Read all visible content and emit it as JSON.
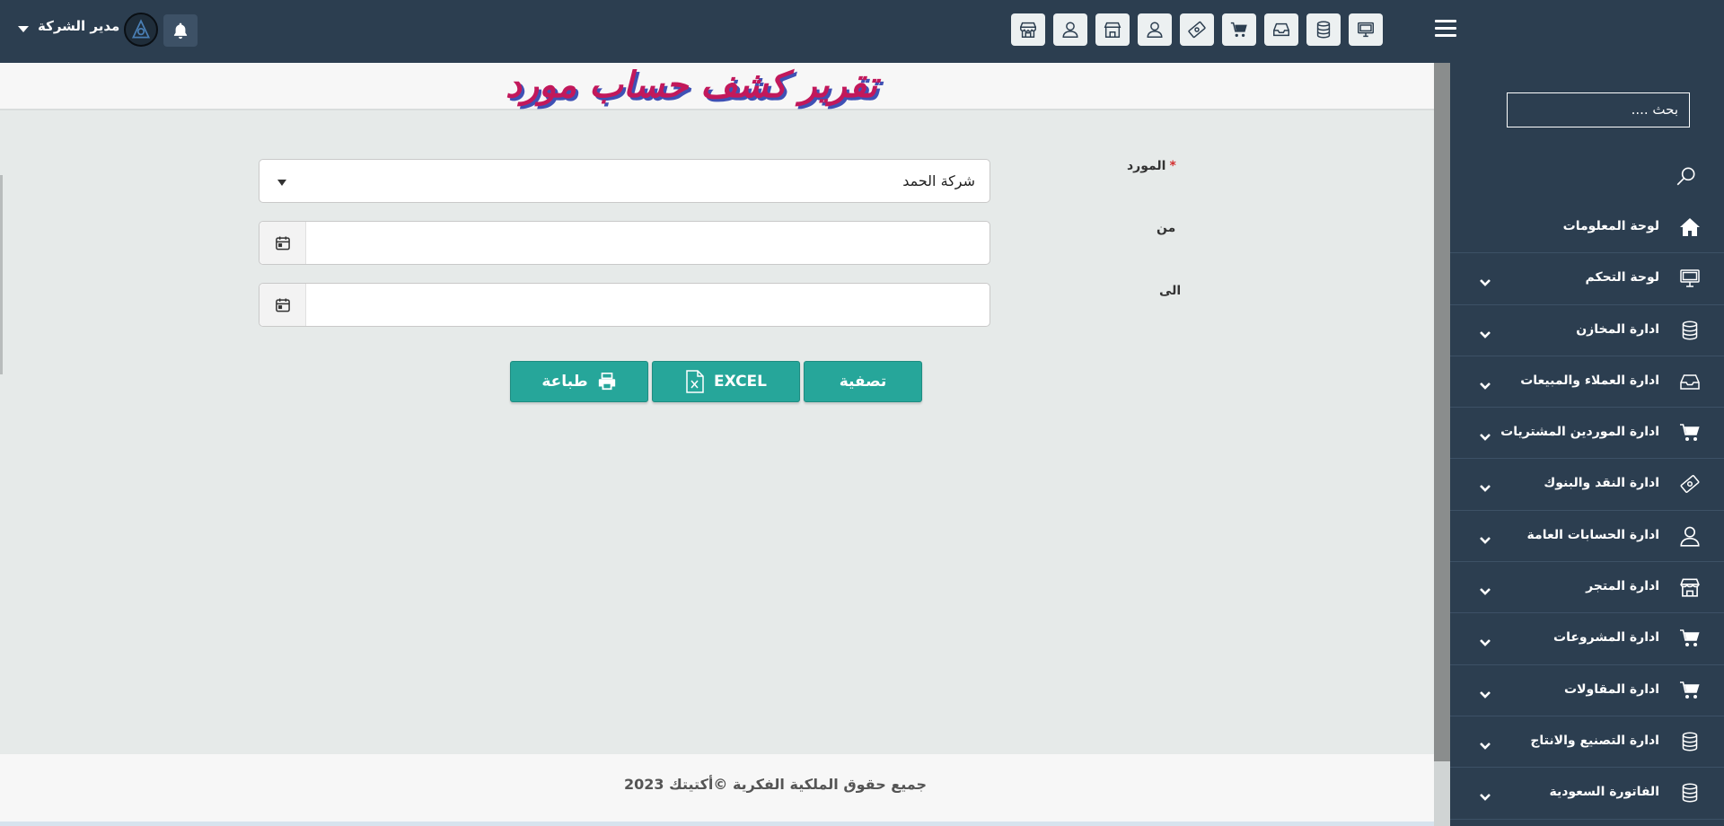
{
  "header": {
    "user_name": "مدير الشركة",
    "icons": [
      "pos-store-icon",
      "user-icon",
      "store-icon",
      "user-icon",
      "money-icon",
      "cart-icon",
      "inbox-icon",
      "database-icon",
      "monitor-icon"
    ]
  },
  "sidebar": {
    "search_placeholder": "بحث ....",
    "items": [
      {
        "label": "لوحة المعلومات",
        "icon": "home-icon",
        "has_children": false
      },
      {
        "label": "لوحة التحكم",
        "icon": "monitor-icon",
        "has_children": true
      },
      {
        "label": "ادارة المخازن",
        "icon": "database-icon",
        "has_children": true
      },
      {
        "label": "ادارة العملاء والمبيعات",
        "icon": "inbox-icon",
        "has_children": true
      },
      {
        "label": "ادارة الموردين المشتريات",
        "icon": "cart-icon",
        "has_children": true
      },
      {
        "label": "ادارة النقد والبنوك",
        "icon": "money-icon",
        "has_children": true
      },
      {
        "label": "ادارة الحسابات العامة",
        "icon": "user-icon",
        "has_children": true
      },
      {
        "label": "ادارة المتجر",
        "icon": "store-icon",
        "has_children": true
      },
      {
        "label": "ادارة المشروعات",
        "icon": "cart-icon",
        "has_children": true
      },
      {
        "label": "ادارة المقاولات",
        "icon": "cart-icon",
        "has_children": true
      },
      {
        "label": "ادارة التصنيع والانتاج",
        "icon": "database-icon",
        "has_children": true
      },
      {
        "label": "الفاتورة السعودية",
        "icon": "database-icon",
        "has_children": true
      }
    ]
  },
  "page": {
    "title": "تقرير كشف حساب مورد"
  },
  "form": {
    "supplier_label": "المورد",
    "supplier_required_mark": "*",
    "supplier_value": "شركة الحمد",
    "from_label": "من",
    "from_value": "",
    "to_label": "الى",
    "to_value": ""
  },
  "buttons": {
    "filter": "تصفية",
    "excel": "EXCEL",
    "print": "طباعة"
  },
  "footer": {
    "text": "جميع حقوق الملكية الفكرية ©أكتيتك 2023"
  },
  "colors": {
    "navbar": "#2c3e50",
    "accent": "#26a69a",
    "title": "#c2185b"
  }
}
